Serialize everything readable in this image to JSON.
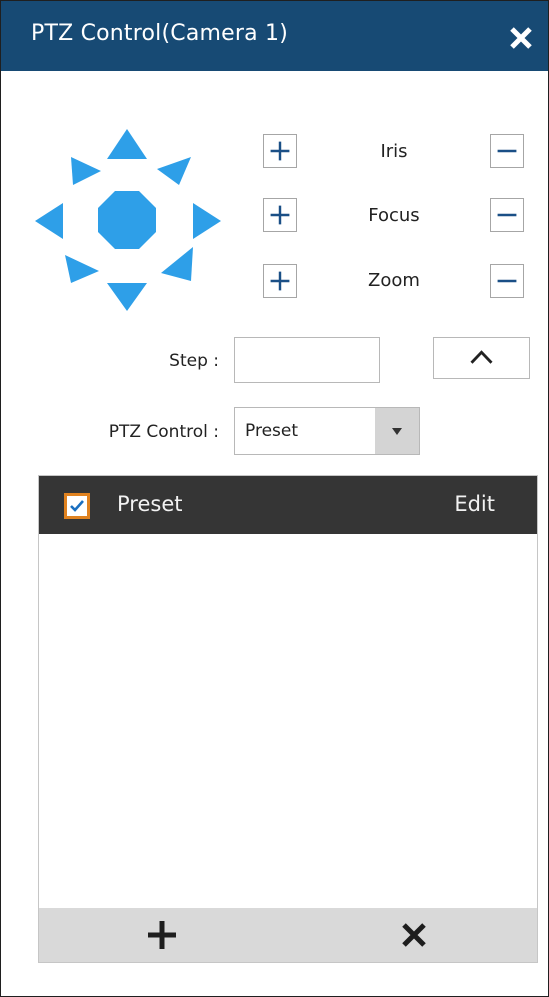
{
  "window": {
    "title": "PTZ Control(Camera 1)",
    "close_icon": "close-icon",
    "title_bar_color": "#174a74"
  },
  "direction_pad": {
    "color": "#2e9fe8",
    "directions": [
      "up",
      "up-right",
      "right",
      "down-right",
      "down",
      "down-left",
      "left",
      "up-left"
    ],
    "center": "stop"
  },
  "lens_controls": [
    {
      "label": "Iris",
      "increase_icon": "plus-icon",
      "decrease_icon": "minus-icon"
    },
    {
      "label": "Focus",
      "increase_icon": "plus-icon",
      "decrease_icon": "minus-icon"
    },
    {
      "label": "Zoom",
      "increase_icon": "plus-icon",
      "decrease_icon": "minus-icon"
    }
  ],
  "step": {
    "label": "Step :",
    "value": "",
    "collapse_icon": "chevron-up-icon"
  },
  "ptz_control": {
    "label": "PTZ Control :",
    "selected": "Preset",
    "dropdown_icon": "caret-down-icon"
  },
  "preset_list": {
    "header_checkbox_checked": true,
    "header_label": "Preset",
    "header_action": "Edit",
    "rows": [],
    "footer_add_icon": "plus-icon",
    "footer_delete_icon": "close-icon"
  }
}
